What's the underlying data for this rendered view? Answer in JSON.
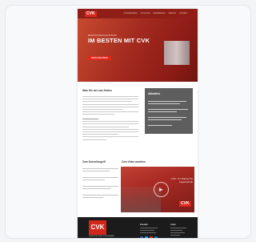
{
  "header": {
    "logo_text": "CVK",
    "nav": [
      "UNTERNEHMEN",
      "PRODUKTE",
      "REFERENZEN",
      "SERVICE",
      "KONTAKT"
    ]
  },
  "hero": {
    "subtitle": "BEHALTEN SIE ALLES IM BLICK",
    "title": "IM BESTEN MIT CVK",
    "button": "MEHR ERFAHREN"
  },
  "intro": {
    "heading": "Was Sie bei uns finden"
  },
  "info_box": {
    "title": "Aktuelles"
  },
  "links_section": {
    "title": "Zum Schnellzugriff"
  },
  "video_section": {
    "title": "Zum Video ansehen",
    "caption": "CVK - Ihr Partner für Lagertechnik",
    "logo_text": "CVK"
  },
  "footer": {
    "logo_text": "CVK",
    "tagline": "LAGERTECHNIK & REGALBAU",
    "contact_title": "Kontakt",
    "links_title": "Links"
  },
  "colors": {
    "brand_red": "#d3261b",
    "dark_red": "#8f1f16",
    "footer_bg": "#1b1b1b",
    "info_bg": "#5e5e5e"
  }
}
